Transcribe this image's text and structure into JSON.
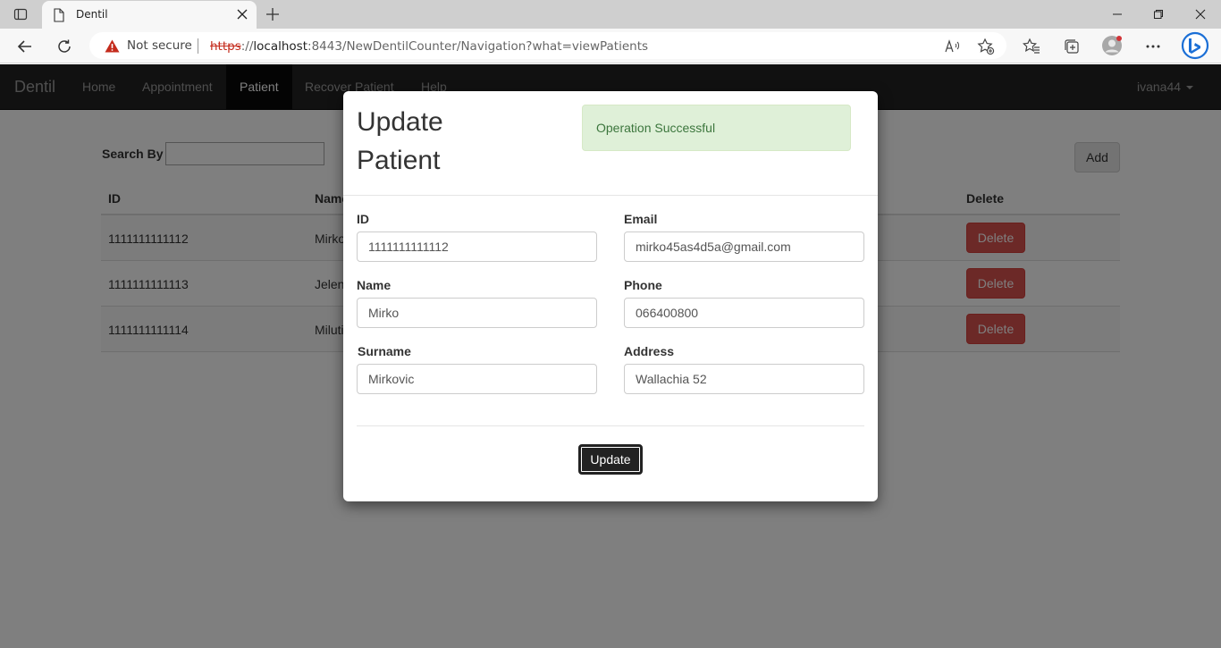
{
  "browser": {
    "tab_title": "Dentil",
    "security_label": "Not secure",
    "url_scheme": "https",
    "url_sep": "://",
    "url_host": "localhost",
    "url_rest": ":8443/NewDentilCounter/Navigation?what=viewPatients"
  },
  "nav": {
    "brand": "Dentil",
    "links": [
      "Home",
      "Appointment",
      "Patient",
      "Recover Patient",
      "Help"
    ],
    "active": "Patient",
    "user": "ivana44"
  },
  "toolbar": {
    "search_label": "Search By",
    "search_value": "",
    "add_label": "Add"
  },
  "table": {
    "headers": {
      "id": "ID",
      "name": "Name",
      "delete": "Delete"
    },
    "rows": [
      {
        "id": "1111111111112",
        "name": "Mirko",
        "delete": "Delete"
      },
      {
        "id": "1111111111113",
        "name": "Jelena",
        "delete": "Delete"
      },
      {
        "id": "1111111111114",
        "name": "Milutin",
        "delete": "Delete"
      }
    ]
  },
  "modal": {
    "title_line1": "Update",
    "title_line2": "Patient",
    "alert": "Operation Successful",
    "fields": {
      "id": {
        "label": "ID",
        "value": "1111111111112"
      },
      "email": {
        "label": "Email",
        "value": "mirko45as4d5a@gmail.com"
      },
      "name": {
        "label": "Name",
        "value": "Mirko"
      },
      "phone": {
        "label": "Phone",
        "value": "066400800"
      },
      "surname": {
        "label": "Surname",
        "value": "Mirkovic"
      },
      "address": {
        "label": "Address",
        "value": "Wallachia 52"
      }
    },
    "submit_label": "Update"
  },
  "colors": {
    "navbar": "#222222",
    "alert_bg": "#dff0d8",
    "alert_text": "#3c763d",
    "danger": "#d9534f"
  }
}
